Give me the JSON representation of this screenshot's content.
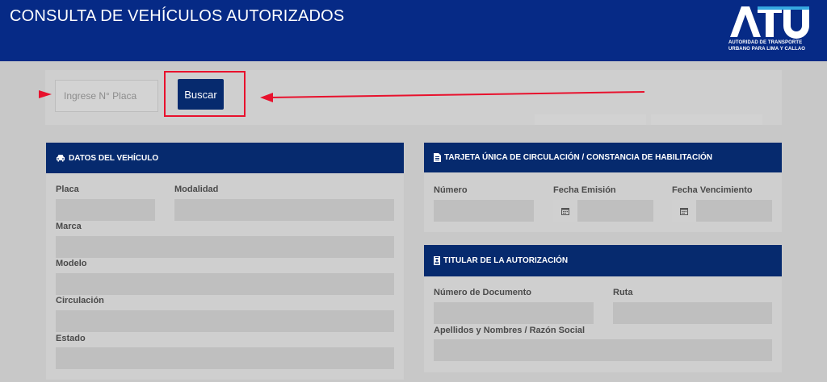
{
  "header": {
    "title": "CONSULTA DE VEHÍCULOS AUTORIZADOS",
    "logo_text": "ATU",
    "logo_line1": "AUTORIDAD DE TRANSPORTE",
    "logo_line2": "URBANO PARA LIMA Y CALLAO"
  },
  "search": {
    "placeholder": "Ingrese N° Placa",
    "value": "",
    "button_label": "Buscar"
  },
  "vehicle_card": {
    "title": "DATOS DEL VEHÍCULO",
    "fields": {
      "placa": {
        "label": "Placa",
        "value": ""
      },
      "modalidad": {
        "label": "Modalidad",
        "value": ""
      },
      "marca": {
        "label": "Marca",
        "value": ""
      },
      "modelo": {
        "label": "Modelo",
        "value": ""
      },
      "circulacion": {
        "label": "Circulación",
        "value": ""
      },
      "estado": {
        "label": "Estado",
        "value": ""
      }
    }
  },
  "tarjeta_card": {
    "title": "TARJETA ÚNICA DE CIRCULACIÓN / CONSTANCIA DE HABILITACIÓN",
    "fields": {
      "numero": {
        "label": "Número",
        "value": ""
      },
      "fecha_emision": {
        "label": "Fecha Emisión",
        "value": ""
      },
      "fecha_vencimiento": {
        "label": "Fecha Vencimiento",
        "value": ""
      }
    }
  },
  "titular_card": {
    "title": "TITULAR DE LA AUTORIZACIÓN",
    "fields": {
      "numero_documento": {
        "label": "Número de Documento",
        "value": ""
      },
      "ruta": {
        "label": "Ruta",
        "value": ""
      },
      "apellidos_nombres": {
        "label": "Apellidos y Nombres / Razón Social",
        "value": ""
      }
    }
  },
  "icons": {
    "vehicle": "car-icon",
    "tarjeta": "document-icon",
    "titular": "id-card-icon",
    "date": "calendar-icon"
  },
  "colors": {
    "header_bg": "#062a86",
    "card_header_bg": "#062a6e",
    "button_bg": "#062a6e",
    "annotation_red": "#e8112d",
    "logo_accent": "#35a8e0"
  }
}
